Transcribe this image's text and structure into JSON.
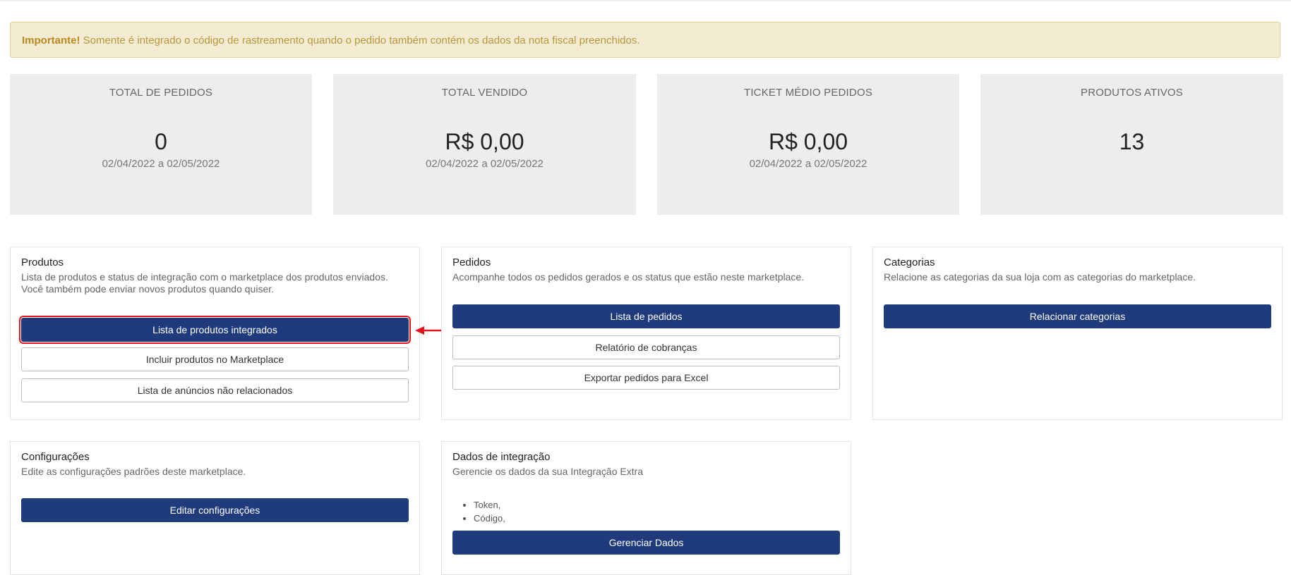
{
  "alert": {
    "strong": "Importante!",
    "text": " Somente é integrado o código de rastreamento quando o pedido também contém os dados da nota fiscal preenchidos."
  },
  "stats": [
    {
      "title": "TOTAL DE PEDIDOS",
      "value": "0",
      "period": "02/04/2022 a 02/05/2022"
    },
    {
      "title": "TOTAL VENDIDO",
      "value": "R$ 0,00",
      "period": "02/04/2022 a 02/05/2022"
    },
    {
      "title": "TICKET MÉDIO PEDIDOS",
      "value": "R$ 0,00",
      "period": "02/04/2022 a 02/05/2022"
    },
    {
      "title": "PRODUTOS ATIVOS",
      "value": "13",
      "period": ""
    }
  ],
  "produtos": {
    "title": "Produtos",
    "desc_line1": "Lista de produtos e status de integração com o marketplace dos produtos enviados.",
    "desc_line2": "Você também pode enviar novos produtos quando quiser.",
    "buttons": [
      "Lista de produtos integrados",
      "Incluir produtos no Marketplace",
      "Lista de anúncios não relacionados"
    ]
  },
  "pedidos": {
    "title": "Pedidos",
    "desc": "Acompanhe todos os pedidos gerados e os status que estão neste marketplace.",
    "buttons": [
      "Lista de pedidos",
      "Relatório de cobranças",
      "Exportar pedidos para Excel"
    ]
  },
  "categorias": {
    "title": "Categorias",
    "desc": "Relacione as categorias da sua loja com as categorias do marketplace.",
    "buttons": [
      "Relacionar categorias"
    ]
  },
  "configuracoes": {
    "title": "Configurações",
    "desc": "Edite as configurações padrões deste marketplace.",
    "buttons": [
      "Editar configurações"
    ]
  },
  "integracao": {
    "title": "Dados de integração",
    "desc": "Gerencie os dados da sua Integração Extra",
    "items": [
      "Token,",
      "Código,"
    ],
    "buttons": [
      "Gerenciar Dados"
    ]
  },
  "colors": {
    "primary": "#1f3b7b",
    "alert_bg": "#f3ecd2",
    "alert_text": "#b8963a",
    "highlight": "#e3141b",
    "stat_bg": "#ededed"
  }
}
